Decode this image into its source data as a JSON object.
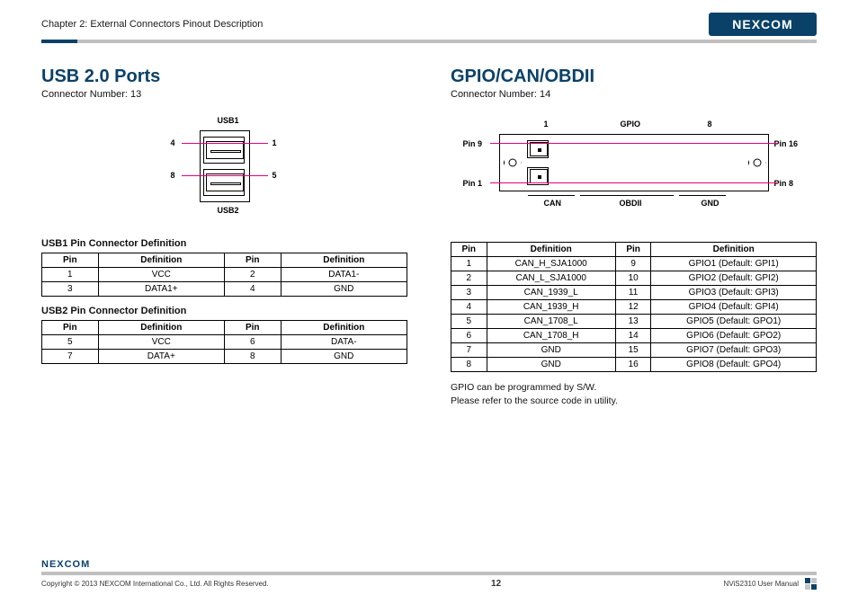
{
  "header": {
    "chapter": "Chapter 2: External Connectors Pinout Description",
    "logo_text": "NEXCOM"
  },
  "left": {
    "title": "USB 2.0 Ports",
    "connector": "Connector Number: 13",
    "diagram": {
      "usb1_label": "USB1",
      "usb2_label": "USB2",
      "n1": "1",
      "n4": "4",
      "n5": "5",
      "n8": "8"
    },
    "table1": {
      "caption": "USB1 Pin Connector Definition",
      "headers": [
        "Pin",
        "Definition",
        "Pin",
        "Definition"
      ],
      "rows": [
        [
          "1",
          "VCC",
          "2",
          "DATA1-"
        ],
        [
          "3",
          "DATA1+",
          "4",
          "GND"
        ]
      ]
    },
    "table2": {
      "caption": "USB2 Pin Connector Definition",
      "headers": [
        "Pin",
        "Definition",
        "Pin",
        "Definition"
      ],
      "rows": [
        [
          "5",
          "VCC",
          "6",
          "DATA-"
        ],
        [
          "7",
          "DATA+",
          "8",
          "GND"
        ]
      ]
    }
  },
  "right": {
    "title": "GPIO/CAN/OBDII",
    "connector": "Connector Number: 14",
    "diagram": {
      "top_left_num": "1",
      "top_mid_label": "GPIO",
      "top_right_num": "8",
      "pin9": "Pin 9",
      "pin16": "Pin 16",
      "pin1": "Pin 1",
      "pin8": "Pin 8",
      "can": "CAN",
      "obdii": "OBDII",
      "gnd": "GND"
    },
    "table": {
      "headers": [
        "Pin",
        "Definition",
        "Pin",
        "Definition"
      ],
      "rows": [
        [
          "1",
          "CAN_H_SJA1000",
          "9",
          "GPIO1 (Default: GPI1)"
        ],
        [
          "2",
          "CAN_L_SJA1000",
          "10",
          "GPIO2 (Default: GPI2)"
        ],
        [
          "3",
          "CAN_1939_L",
          "11",
          "GPIO3 (Default: GPI3)"
        ],
        [
          "4",
          "CAN_1939_H",
          "12",
          "GPIO4 (Default: GPI4)"
        ],
        [
          "5",
          "CAN_1708_L",
          "13",
          "GPIO5 (Default: GPO1)"
        ],
        [
          "6",
          "CAN_1708_H",
          "14",
          "GPIO6 (Default: GPO2)"
        ],
        [
          "7",
          "GND",
          "15",
          "GPIO7 (Default: GPO3)"
        ],
        [
          "8",
          "GND",
          "16",
          "GPIO8 (Default: GPO4)"
        ]
      ]
    },
    "note1": "GPIO can be programmed by S/W.",
    "note2": "Please refer to the source code in utility."
  },
  "footer": {
    "logo_text": "NEXCOM",
    "copyright": "Copyright © 2013 NEXCOM International Co., Ltd. All Rights Reserved.",
    "page": "12",
    "manual": "NViS2310 User Manual"
  }
}
